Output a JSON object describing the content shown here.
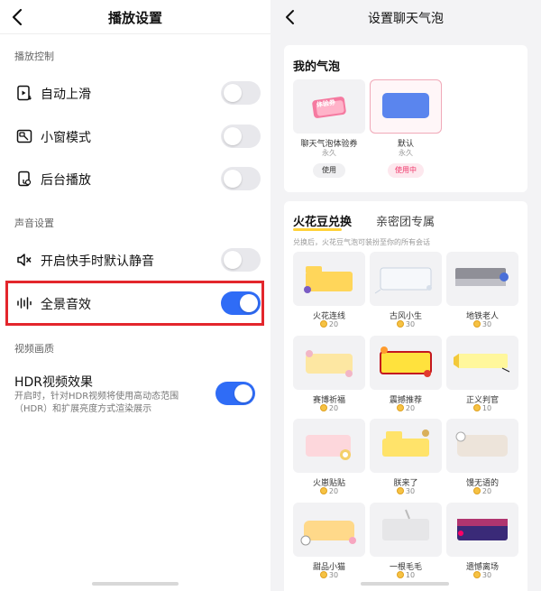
{
  "left": {
    "title": "播放设置",
    "sections": {
      "playback": "播放控制",
      "sound": "声音设置",
      "video": "视频画质"
    },
    "items": {
      "autoplay": {
        "label": "自动上滑",
        "on": false
      },
      "pip": {
        "label": "小窗模式",
        "on": false
      },
      "background": {
        "label": "后台播放",
        "on": false
      },
      "mute": {
        "label": "开启快手时默认静音",
        "on": false
      },
      "spatial": {
        "label": "全景音效",
        "on": true
      }
    },
    "hdr": {
      "title": "HDR视频效果",
      "desc": "开启时，针对HDR视频将使用高动态范围（HDR）和扩展亮度方式渲染展示",
      "on": true
    }
  },
  "right": {
    "title": "设置聊天气泡",
    "mine": {
      "title": "我的气泡",
      "items": [
        {
          "name": "聊天气泡体验券",
          "sub": "永久",
          "action": "使用",
          "badge": "体验券"
        },
        {
          "name": "默认",
          "sub": "永久",
          "action": "使用中"
        }
      ]
    },
    "shop": {
      "tab_active": "火花豆兑换",
      "tab_other": "亲密团专属",
      "note": "兑换后，火花豆气泡可装扮至你的所有会话",
      "bubbles": [
        {
          "name": "火花连线",
          "price": "20"
        },
        {
          "name": "古风小生",
          "price": "30"
        },
        {
          "name": "地铁老人",
          "price": "30"
        },
        {
          "name": "赛博祈福",
          "price": "20"
        },
        {
          "name": "震撼推荐",
          "price": "20"
        },
        {
          "name": "正义判官",
          "price": "10"
        },
        {
          "name": "火崽贴贴",
          "price": "20"
        },
        {
          "name": "朕来了",
          "price": "30"
        },
        {
          "name": "馒无语的",
          "price": "20"
        },
        {
          "name": "甜品小猫",
          "price": "30"
        },
        {
          "name": "一根毛毛",
          "price": "10"
        },
        {
          "name": "遗憾离场",
          "price": "30"
        }
      ]
    }
  },
  "colors": {
    "accent_blue": "#2f6cf6",
    "highlight_red": "#e3262c",
    "pink": "#f0386b",
    "coin": "#f6c243"
  }
}
